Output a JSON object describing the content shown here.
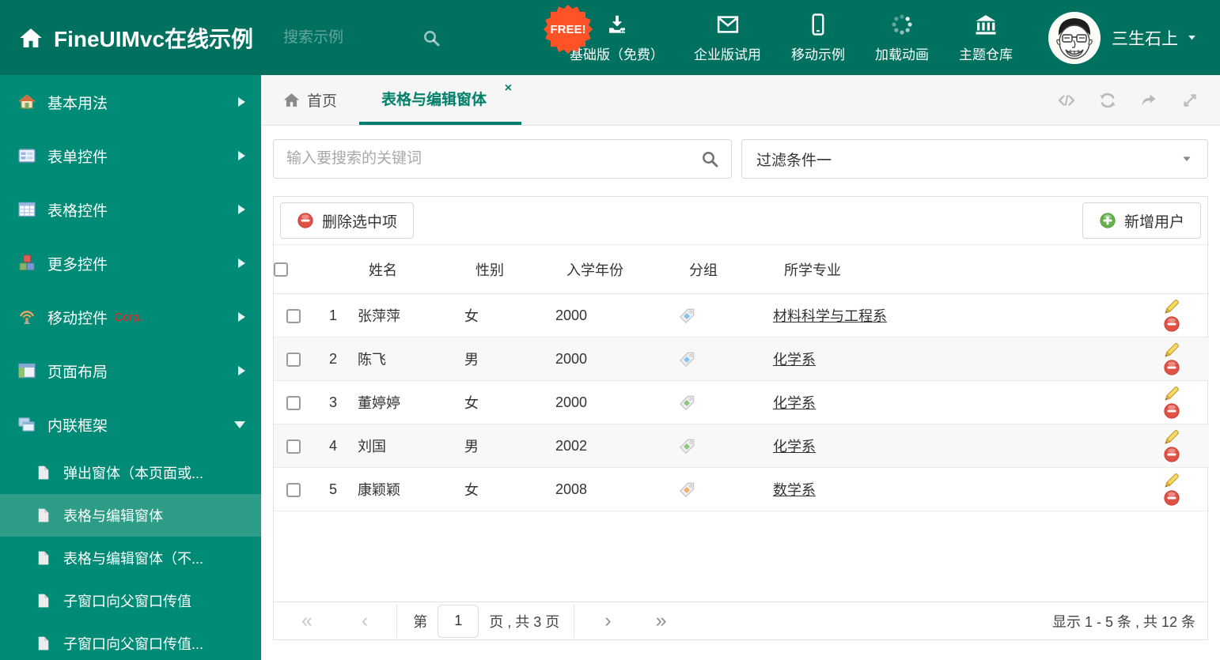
{
  "colors": {
    "header_bg": "#00715F",
    "sidebar_bg": "#008B76",
    "sidebar_active_bg": "#2E9D88",
    "accent": "#00806B",
    "free_badge_bg": "#FF5226",
    "corp_badge_color": "#FF1F1F",
    "delete_red": "#E25146",
    "add_green": "#67B14D",
    "link_color": "#333333"
  },
  "header": {
    "title": "FineUIMvc在线示例",
    "search_placeholder": "搜索示例",
    "free_badge": "FREE!",
    "nav_items": [
      {
        "label": "基础版（免费）",
        "icon": "download-icon"
      },
      {
        "label": "企业版试用",
        "icon": "envelope-icon"
      },
      {
        "label": "移动示例",
        "icon": "mobile-icon"
      },
      {
        "label": "加载动画",
        "icon": "spinner-icon"
      },
      {
        "label": "主题仓库",
        "icon": "bank-icon"
      }
    ],
    "user_name": "三生石上"
  },
  "sidebar": {
    "items": [
      {
        "label": "基本用法",
        "icon": "home-colored-icon"
      },
      {
        "label": "表单控件",
        "icon": "form-icon"
      },
      {
        "label": "表格控件",
        "icon": "grid-icon"
      },
      {
        "label": "更多控件",
        "icon": "cubes-icon"
      },
      {
        "label": "移动控件",
        "badge": "Corp.",
        "icon": "antenna-icon"
      },
      {
        "label": "页面布局",
        "icon": "layout-icon"
      },
      {
        "label": "内联框架",
        "icon": "frames-icon",
        "expanded": true
      }
    ],
    "subitems": [
      {
        "label": "弹出窗体（本页面或..."
      },
      {
        "label": "表格与编辑窗体",
        "active": true
      },
      {
        "label": "表格与编辑窗体（不..."
      },
      {
        "label": "子窗口向父窗口传值"
      },
      {
        "label": "子窗口向父窗口传值..."
      }
    ]
  },
  "tabs": {
    "home_label": "首页",
    "active_label": "表格与编辑窗体",
    "close_glyph": "×"
  },
  "filters": {
    "search_placeholder": "输入要搜索的关键词",
    "filter_value": "过滤条件一"
  },
  "grid": {
    "delete_button_label": "删除选中项",
    "add_button_label": "新增用户",
    "columns": {
      "name": "姓名",
      "gender": "性别",
      "year": "入学年份",
      "group": "分组",
      "major": "所学专业"
    },
    "rows": [
      {
        "num": "1",
        "name": "张萍萍",
        "gender": "女",
        "year": "2000",
        "tag_color": "#7FC3EF",
        "major": "材料科学与工程系"
      },
      {
        "num": "2",
        "name": "陈飞",
        "gender": "男",
        "year": "2000",
        "tag_color": "#7FC3EF",
        "major": "化学系"
      },
      {
        "num": "3",
        "name": "董婷婷",
        "gender": "女",
        "year": "2000",
        "tag_color": "#8CC57E",
        "major": "化学系"
      },
      {
        "num": "4",
        "name": "刘国",
        "gender": "男",
        "year": "2002",
        "tag_color": "#8CC57E",
        "major": "化学系"
      },
      {
        "num": "5",
        "name": "康颖颖",
        "gender": "女",
        "year": "2008",
        "tag_color": "#F4AD68",
        "major": "数学系"
      }
    ]
  },
  "pagination": {
    "first_glyph": "«",
    "prev_glyph": "‹",
    "page_prefix": "第",
    "page_value": "1",
    "page_suffix": "页 , 共 3 页",
    "next_glyph": "›",
    "last_glyph": "»",
    "summary": "显示 1 - 5 条 , 共 12 条"
  }
}
